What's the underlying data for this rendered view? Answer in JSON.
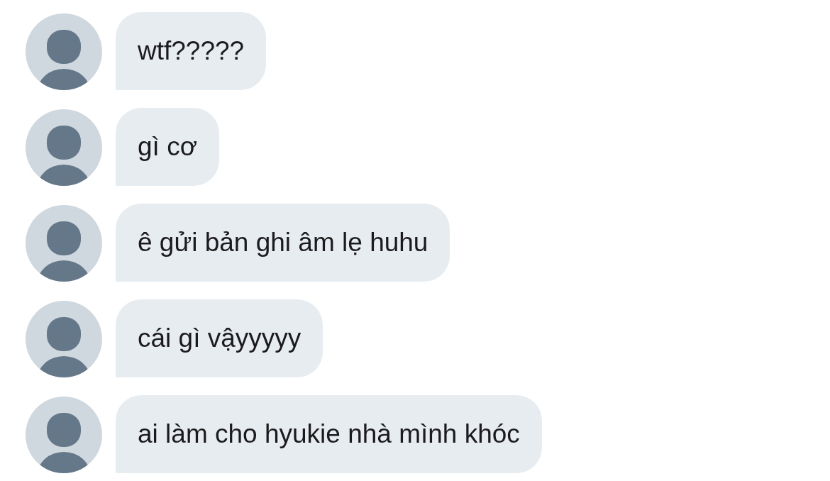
{
  "messages": [
    {
      "text": "wtf?????"
    },
    {
      "text": "gì cơ"
    },
    {
      "text": "ê gửi bản ghi âm lẹ huhu"
    },
    {
      "text": "cái gì vậyyyyy"
    },
    {
      "text": "ai làm cho hyukie nhà mình khóc"
    }
  ]
}
